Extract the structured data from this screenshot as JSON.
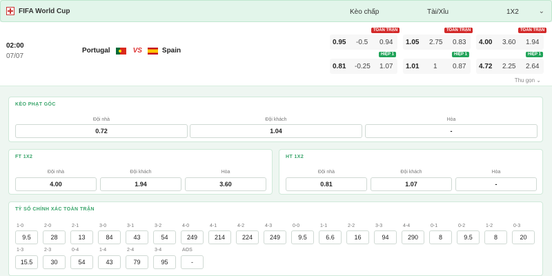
{
  "header": {
    "title": "FIFA World Cup",
    "col_handicap": "Kèo chấp",
    "col_overunder": "Tài/Xỉu",
    "col_1x2": "1X2"
  },
  "match": {
    "time": "02:00",
    "date": "07/07",
    "home": "Portugal",
    "away": "Spain",
    "vs": "VS",
    "tag_full": "TOÀN TRẬN",
    "tag_half": "HIỆP 1",
    "collapse": "Thu gọn",
    "full": {
      "handicap": [
        "0.95",
        "-0.5",
        "0.94"
      ],
      "overunder": [
        "1.05",
        "2.75",
        "0.83"
      ],
      "x12": [
        "4.00",
        "3.60",
        "1.94"
      ]
    },
    "half": {
      "handicap": [
        "0.81",
        "-0.25",
        "1.07"
      ],
      "overunder": [
        "1.01",
        "1",
        "0.87"
      ],
      "x12": [
        "4.72",
        "2.25",
        "2.64"
      ]
    }
  },
  "corner": {
    "title": "KÈO PHẠT GÓC",
    "labels": [
      "Đội nhà",
      "Đội khách",
      "Hòa"
    ],
    "values": [
      "0.72",
      "1.04",
      "-"
    ]
  },
  "ft": {
    "title": "FT 1X2",
    "labels": [
      "Đội nhà",
      "Đội khách",
      "Hòa"
    ],
    "values": [
      "4.00",
      "1.94",
      "3.60"
    ]
  },
  "ht": {
    "title": "HT 1X2",
    "labels": [
      "Đội nhà",
      "Đội khách",
      "Hòa"
    ],
    "values": [
      "0.81",
      "1.07",
      "-"
    ]
  },
  "correct": {
    "title": "TỶ SỐ CHÍNH XÁC TOÀN TRẬN",
    "row1": [
      {
        "s": "1-0",
        "v": "9.5"
      },
      {
        "s": "2-0",
        "v": "28"
      },
      {
        "s": "2-1",
        "v": "13"
      },
      {
        "s": "3-0",
        "v": "84"
      },
      {
        "s": "3-1",
        "v": "43"
      },
      {
        "s": "3-2",
        "v": "54"
      },
      {
        "s": "4-0",
        "v": "249"
      },
      {
        "s": "4-1",
        "v": "214"
      },
      {
        "s": "4-2",
        "v": "224"
      },
      {
        "s": "4-3",
        "v": "249"
      },
      {
        "s": "0-0",
        "v": "9.5"
      },
      {
        "s": "1-1",
        "v": "6.6"
      },
      {
        "s": "2-2",
        "v": "16"
      },
      {
        "s": "3-3",
        "v": "94"
      },
      {
        "s": "4-4",
        "v": "290"
      },
      {
        "s": "0-1",
        "v": "8"
      },
      {
        "s": "0-2",
        "v": "9.5"
      },
      {
        "s": "1-2",
        "v": "8"
      },
      {
        "s": "0-3",
        "v": "20"
      }
    ],
    "row2": [
      {
        "s": "1-3",
        "v": "15.5"
      },
      {
        "s": "2-3",
        "v": "30"
      },
      {
        "s": "0-4",
        "v": "54"
      },
      {
        "s": "1-4",
        "v": "43"
      },
      {
        "s": "2-4",
        "v": "79"
      },
      {
        "s": "3-4",
        "v": "95"
      },
      {
        "s": "AOS",
        "v": "-"
      }
    ]
  }
}
